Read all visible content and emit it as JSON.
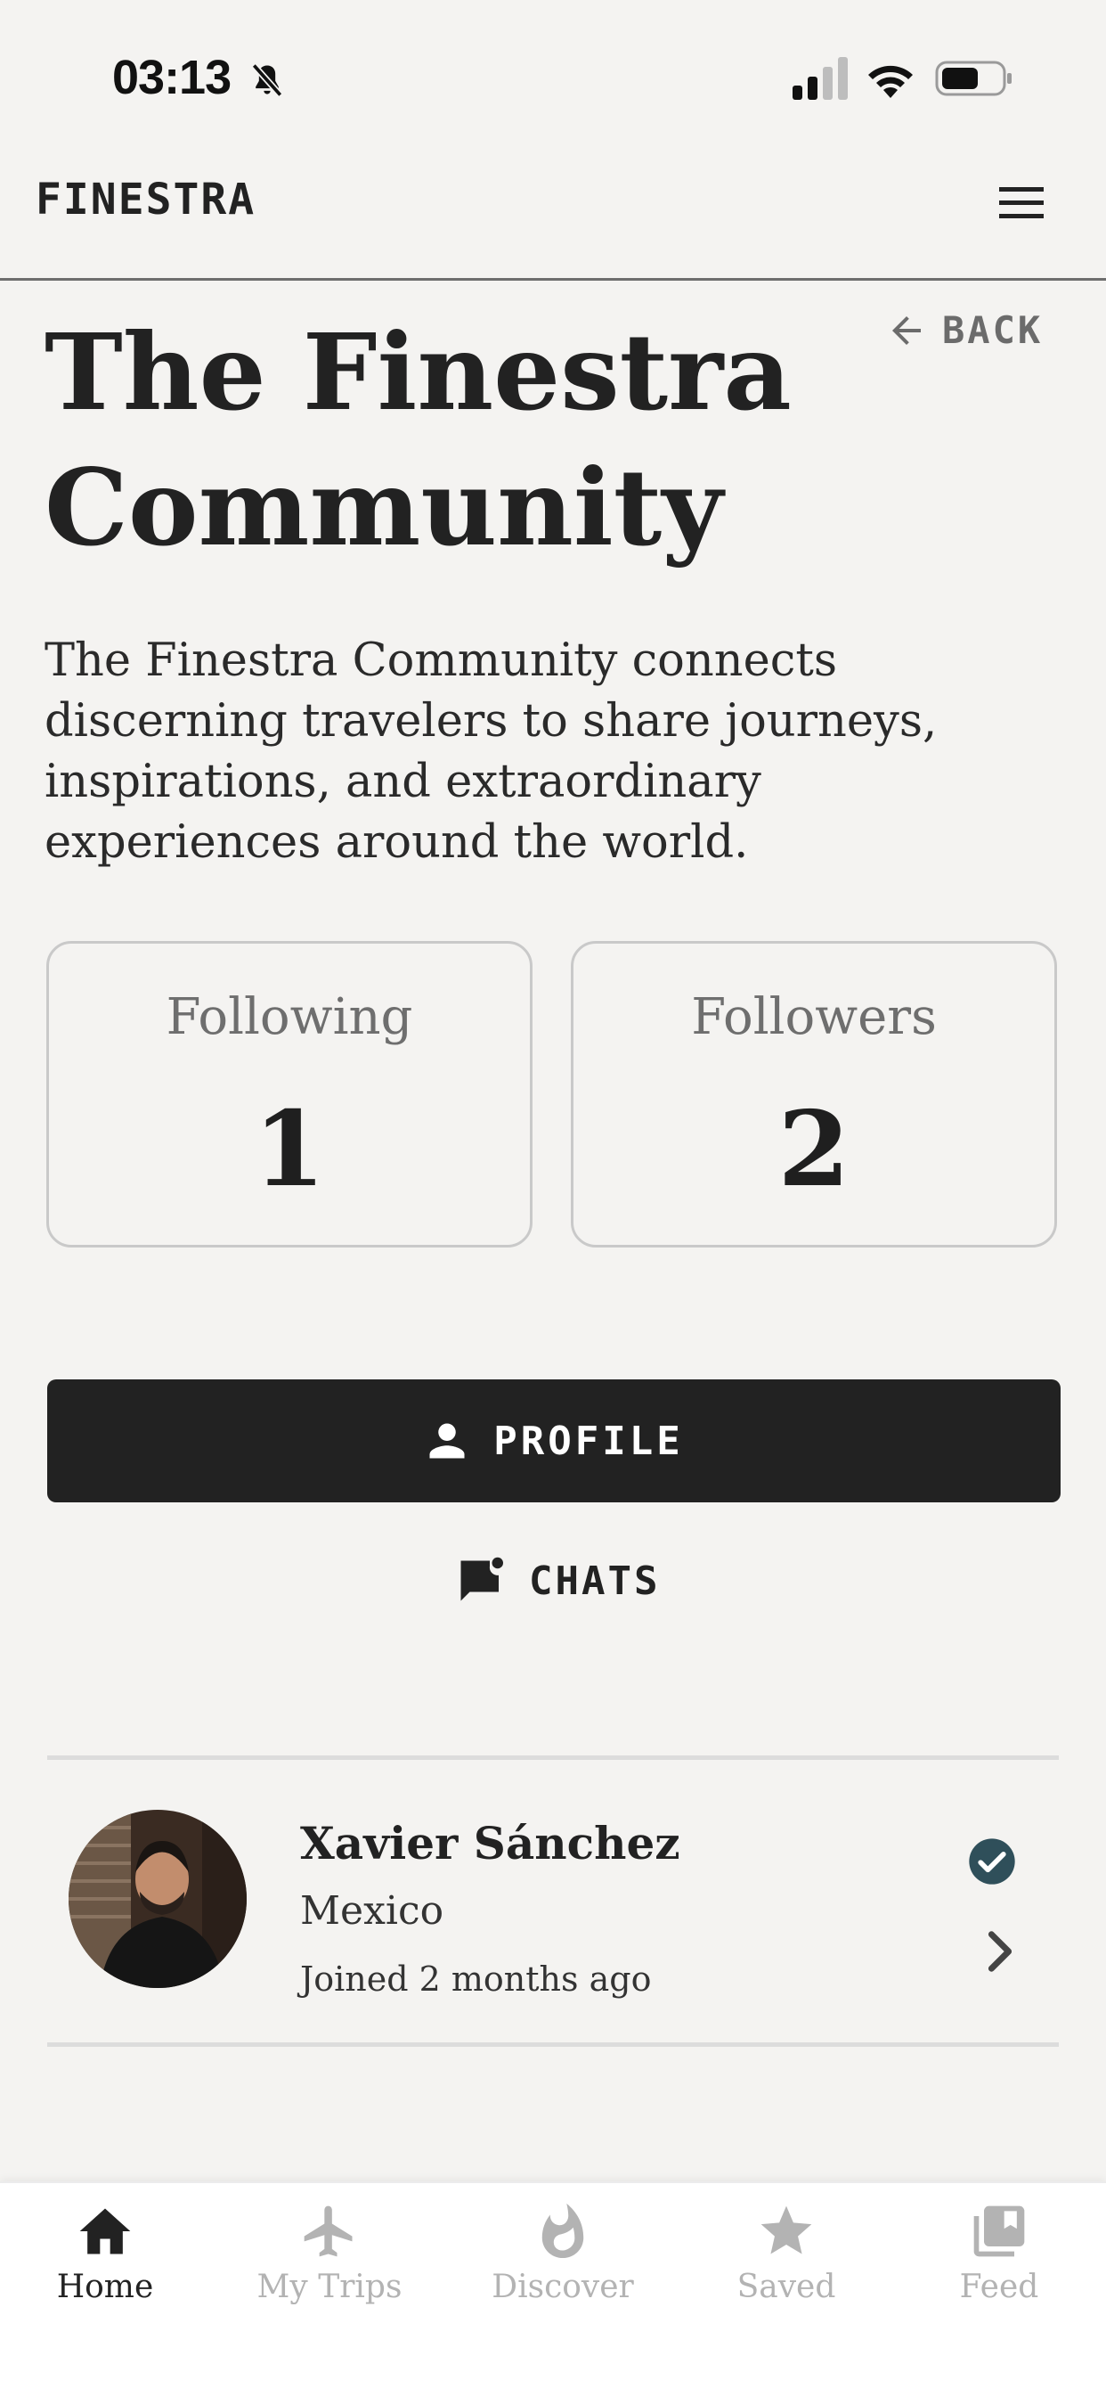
{
  "status_bar": {
    "time": "03:13"
  },
  "header": {
    "brand": "FINESTRA"
  },
  "back": {
    "label": "BACK"
  },
  "page": {
    "title": "The Finestra Community",
    "intro": "The Finestra Community connects discerning travelers to share journeys, inspirations, and extraordinary experiences around the world."
  },
  "stats": [
    {
      "label": "Following",
      "value": "1"
    },
    {
      "label": "Followers",
      "value": "2"
    }
  ],
  "actions": {
    "profile": "PROFILE",
    "chats": "CHATS"
  },
  "members": [
    {
      "name": "Xavier Sánchez",
      "country": "Mexico",
      "joined": "Joined 2 months ago",
      "verified": true
    }
  ],
  "tabs": [
    {
      "label": "Home",
      "icon": "home-icon",
      "active": true
    },
    {
      "label": "My Trips",
      "icon": "airplane-icon",
      "active": false
    },
    {
      "label": "Discover",
      "icon": "flame-icon",
      "active": false
    },
    {
      "label": "Saved",
      "icon": "star-icon",
      "active": false
    },
    {
      "label": "Feed",
      "icon": "library-icon",
      "active": false
    }
  ],
  "colors": {
    "background": "#f4f3f1",
    "primary": "#222222",
    "verified": "#2f4f5a",
    "tab_inactive": "#b3b3b3"
  }
}
